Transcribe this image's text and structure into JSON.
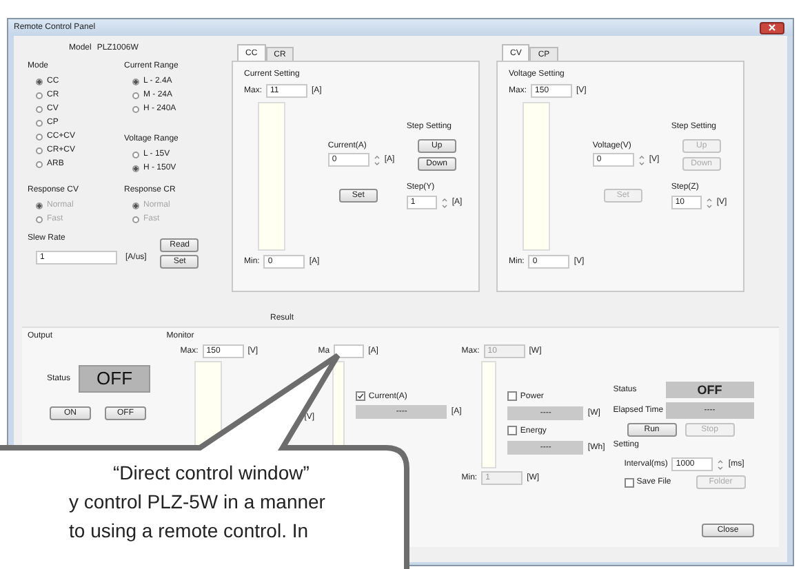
{
  "window": {
    "title": "Remote Control Panel"
  },
  "model": {
    "label": "Model",
    "value": "PLZ1006W"
  },
  "mode": {
    "label": "Mode",
    "options": [
      {
        "label": "CC",
        "selected": true
      },
      {
        "label": "CR",
        "selected": false
      },
      {
        "label": "CV",
        "selected": false
      },
      {
        "label": "CP",
        "selected": false
      },
      {
        "label": "CC+CV",
        "selected": false
      },
      {
        "label": "CR+CV",
        "selected": false
      },
      {
        "label": "ARB",
        "selected": false
      }
    ]
  },
  "current_range": {
    "label": "Current Range",
    "options": [
      {
        "label": "L - 2.4A",
        "selected": true
      },
      {
        "label": "M - 24A",
        "selected": false
      },
      {
        "label": "H - 240A",
        "selected": false
      }
    ]
  },
  "voltage_range": {
    "label": "Voltage Range",
    "options": [
      {
        "label": "L - 15V",
        "selected": false
      },
      {
        "label": "H - 150V",
        "selected": true
      }
    ]
  },
  "response_cv": {
    "label": "Response CV",
    "disabled": true,
    "options": [
      {
        "label": "Normal",
        "selected": true
      },
      {
        "label": "Fast",
        "selected": false
      }
    ]
  },
  "response_cr": {
    "label": "Response CR",
    "disabled": true,
    "options": [
      {
        "label": "Normal",
        "selected": true
      },
      {
        "label": "Fast",
        "selected": false
      }
    ]
  },
  "slew_rate": {
    "label": "Slew Rate",
    "value": "1",
    "unit": "[A/us]",
    "buttons": [
      "Read",
      "Set"
    ]
  },
  "setting_panels": [
    {
      "tabs": [
        {
          "label": "CC",
          "selected": true
        },
        {
          "label": "CR",
          "selected": false
        }
      ],
      "title": "Current Setting",
      "disabled": false,
      "max": {
        "label": "Max:",
        "value": "11",
        "unit": "[A]"
      },
      "setting": {
        "label": "Current(A)",
        "value": "0",
        "unit": "[A]"
      },
      "set_button": "Set",
      "step_title": "Step Setting",
      "up_button": "Up",
      "down_button": "Down",
      "step": {
        "label": "Step(Y)",
        "value": "1",
        "unit": "[A]"
      },
      "min": {
        "label": "Min:",
        "value": "0",
        "unit": "[A]"
      }
    },
    {
      "tabs": [
        {
          "label": "CV",
          "selected": true
        },
        {
          "label": "CP",
          "selected": false
        }
      ],
      "title": "Voltage Setting",
      "disabled": true,
      "max": {
        "label": "Max:",
        "value": "150",
        "unit": "[V]"
      },
      "setting": {
        "label": "Voltage(V)",
        "value": "0",
        "unit": "[V]"
      },
      "set_button": "Set",
      "step_title": "Step Setting",
      "up_button": "Up",
      "down_button": "Down",
      "step": {
        "label": "Step(Z)",
        "value": "10",
        "unit": "[V]"
      },
      "min": {
        "label": "Min:",
        "value": "0",
        "unit": "[V]"
      }
    }
  ],
  "result_label": "Result",
  "output": {
    "title": "Output",
    "status_label": "Status",
    "status": "OFF",
    "buttons": [
      "ON",
      "OFF"
    ]
  },
  "monitor": {
    "title": "Monitor",
    "voltage": {
      "max_label": "Max:",
      "max_value": "150",
      "max_unit": "[V]",
      "unit": "[V]"
    },
    "current": {
      "max_label": "Ma",
      "max_unit": "[A]",
      "label": "Current(A)",
      "checked": true,
      "reading": "----",
      "unit": "[A]"
    },
    "power": {
      "max_label": "Max:",
      "max_value": "10",
      "max_unit": "[W]",
      "min_label": "Min:",
      "min_value": "1",
      "min_unit": "[W]",
      "items": [
        {
          "label": "Power",
          "checked": false,
          "reading": "----",
          "unit": "[W]"
        },
        {
          "label": "Energy",
          "checked": false,
          "reading": "----",
          "unit": "[Wh]"
        }
      ]
    }
  },
  "logging": {
    "status_label": "Status",
    "status": "OFF",
    "elapsed_label": "Elapsed Time",
    "elapsed": "----",
    "run": {
      "label": "Run",
      "disabled": false
    },
    "stop": {
      "label": "Stop",
      "disabled": true
    },
    "setting_title": "Setting",
    "interval": {
      "label": "Interval(ms)",
      "value": "1000",
      "unit": "[ms]"
    },
    "save_file": {
      "label": "Save File",
      "checked": false
    },
    "folder": {
      "label": "Folder",
      "disabled": true
    }
  },
  "close_button": "Close",
  "callout": {
    "lines": [
      "“Direct control window”",
      "y control PLZ-5W in a manner",
      "to using a remote control. In"
    ]
  }
}
